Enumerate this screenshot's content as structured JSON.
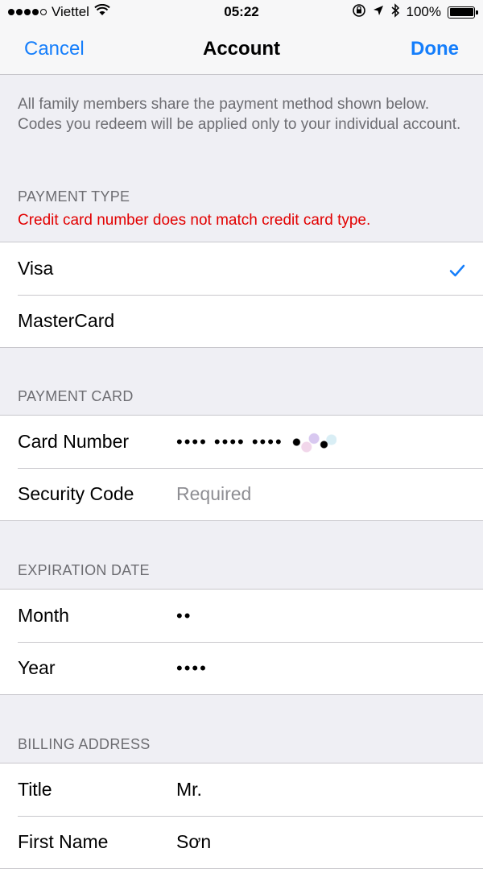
{
  "status_bar": {
    "carrier": "Viettel",
    "time": "05:22",
    "battery": "100%",
    "icons": [
      "signal-icon",
      "wifi-icon",
      "orientation-lock-icon",
      "location-icon",
      "bluetooth-icon",
      "battery-icon"
    ]
  },
  "nav": {
    "cancel_label": "Cancel",
    "title": "Account",
    "done_label": "Done"
  },
  "info_text": "All family members share the payment method shown below. Codes you redeem will be applied only to your individual account.",
  "payment_type": {
    "header": "PAYMENT TYPE",
    "error": "Credit card number does not match credit card type.",
    "options": [
      {
        "label": "Visa",
        "selected": true
      },
      {
        "label": "MasterCard",
        "selected": false
      }
    ]
  },
  "payment_card": {
    "header": "PAYMENT CARD",
    "card_number_label": "Card Number",
    "card_number_value": "•••• •••• ••••",
    "security_code_label": "Security Code",
    "security_code_placeholder": "Required"
  },
  "expiration": {
    "header": "EXPIRATION DATE",
    "month_label": "Month",
    "month_value": "••",
    "year_label": "Year",
    "year_value": "••••"
  },
  "billing": {
    "header": "BILLING ADDRESS",
    "title_label": "Title",
    "title_value": "Mr.",
    "first_name_label": "First Name",
    "first_name_value": "Sơn"
  },
  "colors": {
    "accent": "#157efb",
    "error": "#e20000",
    "background": "#efeff4"
  }
}
